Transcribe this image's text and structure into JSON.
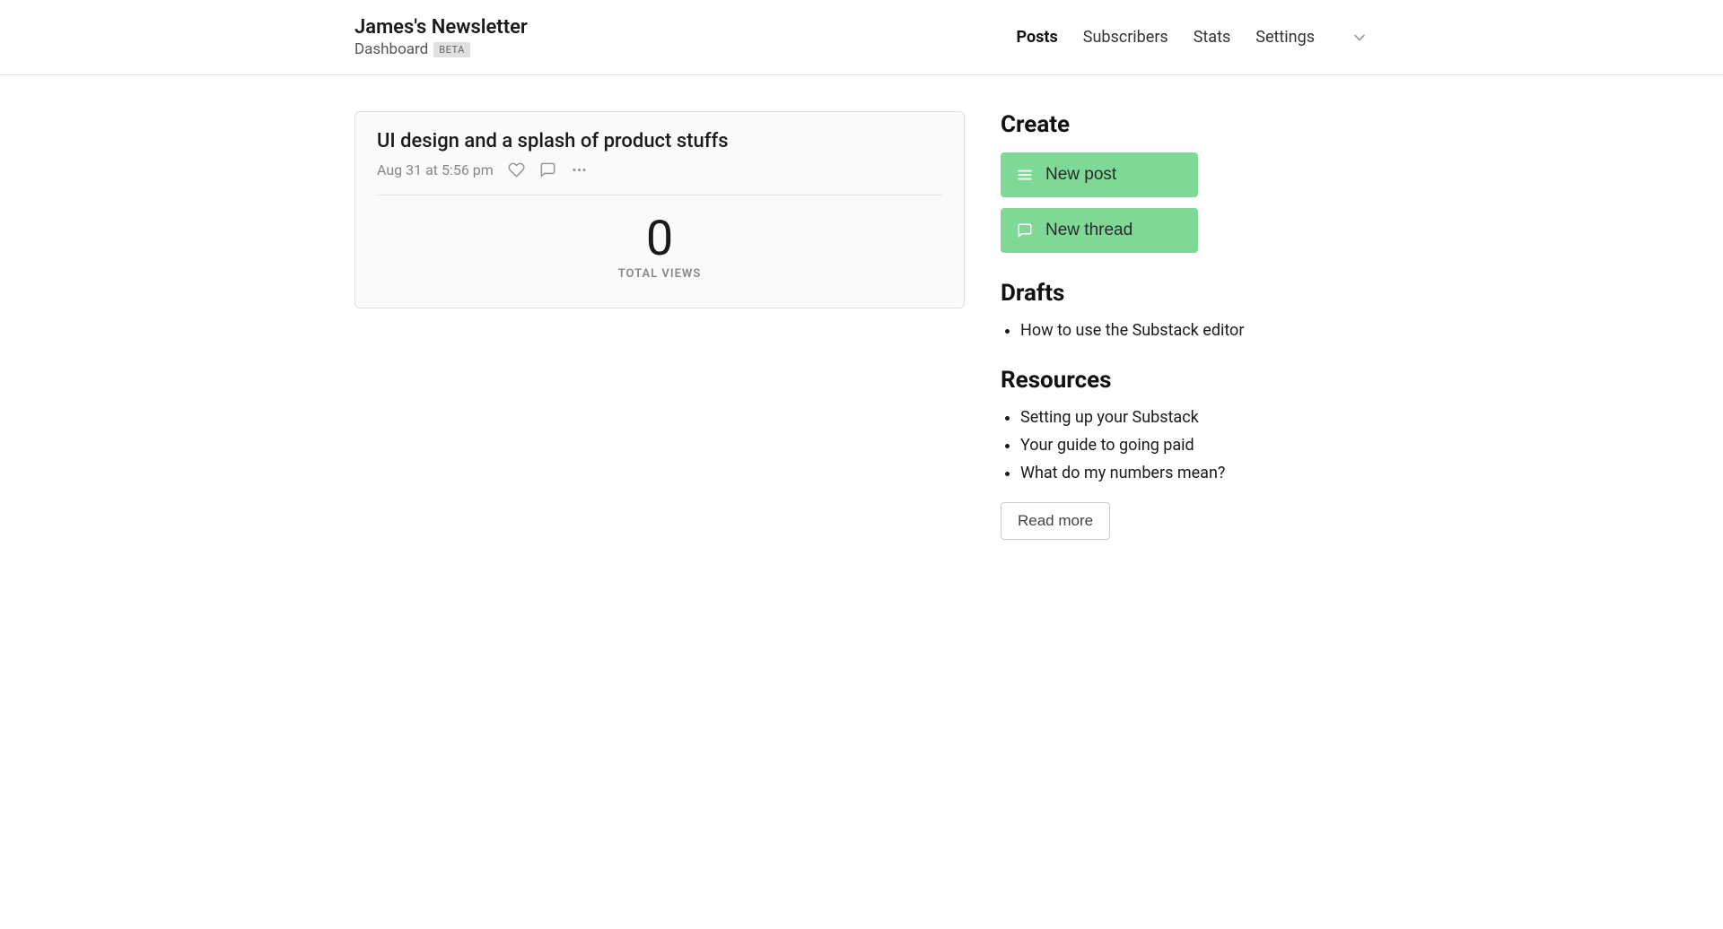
{
  "header": {
    "title": "James's Newsletter",
    "dashboard_label": "Dashboard",
    "beta_label": "BETA",
    "nav": {
      "posts": "Posts",
      "subscribers": "Subscribers",
      "stats": "Stats",
      "settings": "Settings"
    }
  },
  "post": {
    "title": "UI design and a splash of product stuffs",
    "date": "Aug 31 at 5:56 pm",
    "views_count": "0",
    "views_label": "TOTAL VIEWS"
  },
  "sidebar": {
    "create": {
      "heading": "Create",
      "new_post": "New post",
      "new_thread": "New thread"
    },
    "drafts": {
      "heading": "Drafts",
      "items": [
        "How to use the Substack editor"
      ]
    },
    "resources": {
      "heading": "Resources",
      "items": [
        "Setting up your Substack",
        "Your guide to going paid",
        "What do my numbers mean?"
      ],
      "read_more": "Read more"
    }
  }
}
